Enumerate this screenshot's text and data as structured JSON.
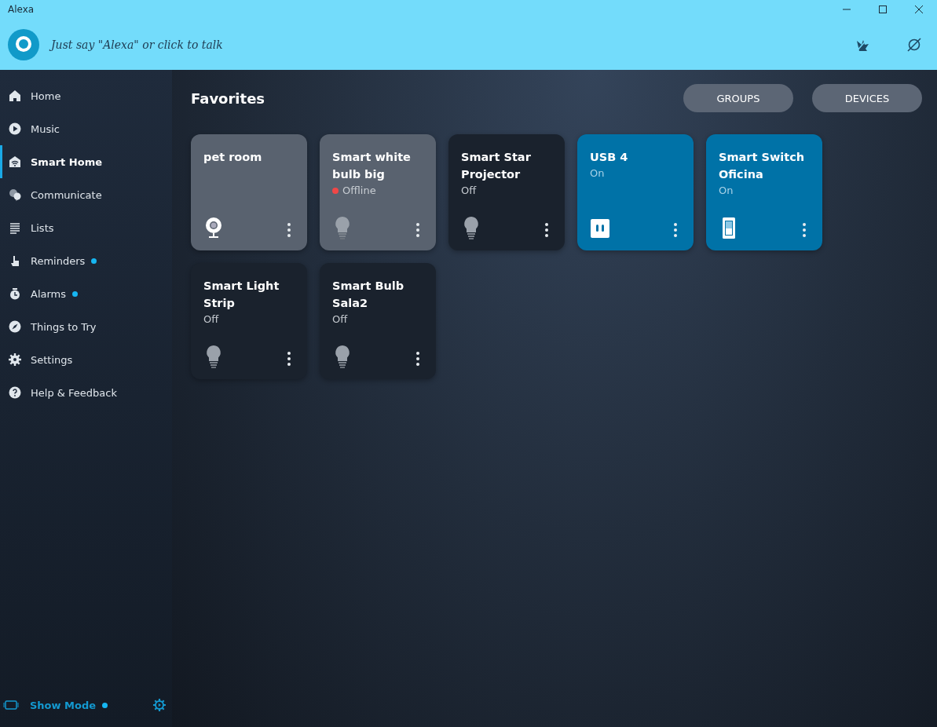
{
  "window": {
    "title": "Alexa"
  },
  "header": {
    "prompt": "Just say \"Alexa\" or click to talk"
  },
  "sidebar": {
    "items": [
      {
        "label": "Home",
        "selected": false,
        "badge": false
      },
      {
        "label": "Music",
        "selected": false,
        "badge": false
      },
      {
        "label": "Smart Home",
        "selected": true,
        "badge": false
      },
      {
        "label": "Communicate",
        "selected": false,
        "badge": false
      },
      {
        "label": "Lists",
        "selected": false,
        "badge": false
      },
      {
        "label": "Reminders",
        "selected": false,
        "badge": true
      },
      {
        "label": "Alarms",
        "selected": false,
        "badge": true
      },
      {
        "label": "Things to Try",
        "selected": false,
        "badge": false
      },
      {
        "label": "Settings",
        "selected": false,
        "badge": false
      },
      {
        "label": "Help & Feedback",
        "selected": false,
        "badge": false
      }
    ],
    "show_mode": {
      "label": "Show Mode",
      "badge": true
    }
  },
  "main": {
    "title": "Favorites",
    "buttons": [
      "GROUPS",
      "DEVICES"
    ],
    "devices": [
      {
        "name": "pet room",
        "kind": "camera",
        "on": false,
        "unavailable": true,
        "offline": false
      },
      {
        "name": "Smart white bulb big",
        "kind": "bulb",
        "on": false,
        "unavailable": true,
        "offline": true,
        "status": "Offline"
      },
      {
        "name": "Smart Star Projector",
        "kind": "bulb",
        "on": false,
        "unavailable": false,
        "offline": false,
        "status": "Off"
      },
      {
        "name": "USB 4",
        "kind": "plug",
        "on": true,
        "unavailable": false,
        "offline": false,
        "status": "On"
      },
      {
        "name": "Smart Switch Oficina",
        "kind": "switch",
        "on": true,
        "unavailable": false,
        "offline": false,
        "status": "On"
      },
      {
        "name": "Smart Light Strip",
        "kind": "bulb",
        "on": false,
        "unavailable": false,
        "offline": false,
        "status": "Off"
      },
      {
        "name": "Smart Bulb Sala2",
        "kind": "bulb",
        "on": false,
        "unavailable": false,
        "offline": false,
        "status": "Off"
      }
    ]
  }
}
